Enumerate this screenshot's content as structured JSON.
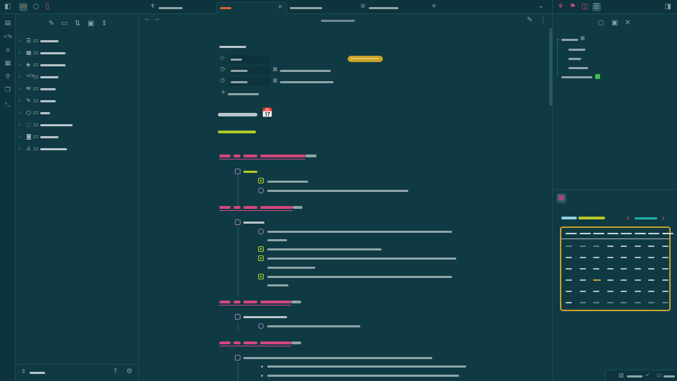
{
  "colors": {
    "background": "#0f3a44",
    "sidebar": "#0d343d",
    "border": "#1b4b55",
    "heading_accent": "#d8457e",
    "done_accent": "#b5c925",
    "tag_accent": "#c8a12b",
    "calendar_frame": "#c8a12b",
    "calendar_title": "#22b0b0",
    "tab_active_marker": "#e0602b"
  },
  "ribbon_icons": [
    "file-icon",
    "code-icon",
    "home-icon",
    "calendar-icon",
    "graph-icon",
    "copy-icon",
    "terminal-icon"
  ],
  "topleft_icons": [
    "sidebar-toggle-icon",
    "folder-icon",
    "search-icon",
    "bookmark-icon"
  ],
  "explorer": {
    "toolbar_icons": [
      "new-note-icon",
      "new-folder-icon",
      "sort-icon",
      "collapse-icon",
      "expand-icon"
    ],
    "folder_icons": [
      "list-icon",
      "calendar-icon",
      "stack-icon",
      "code-icon",
      "mail-icon",
      "pencil-icon",
      "circle-icon",
      "mouse-icon",
      "camera-icon",
      "person-icon"
    ]
  },
  "tabs": {
    "close_glyph": "✕",
    "new_tab_glyph": "+",
    "menu_glyph": "⌄"
  },
  "editor": {
    "calendar_emoji": "📅",
    "add_property_glyph": "+"
  },
  "right_icons": [
    "graph-icon",
    "tag-icon",
    "backlink-icon",
    "outline-icon",
    "sidebar-right-icon"
  ],
  "calendar": {
    "prev_glyph": "‹",
    "next_glyph": "›"
  },
  "statusbar_icons": [
    "book-icon",
    "check-icon",
    "window-icon"
  ]
}
